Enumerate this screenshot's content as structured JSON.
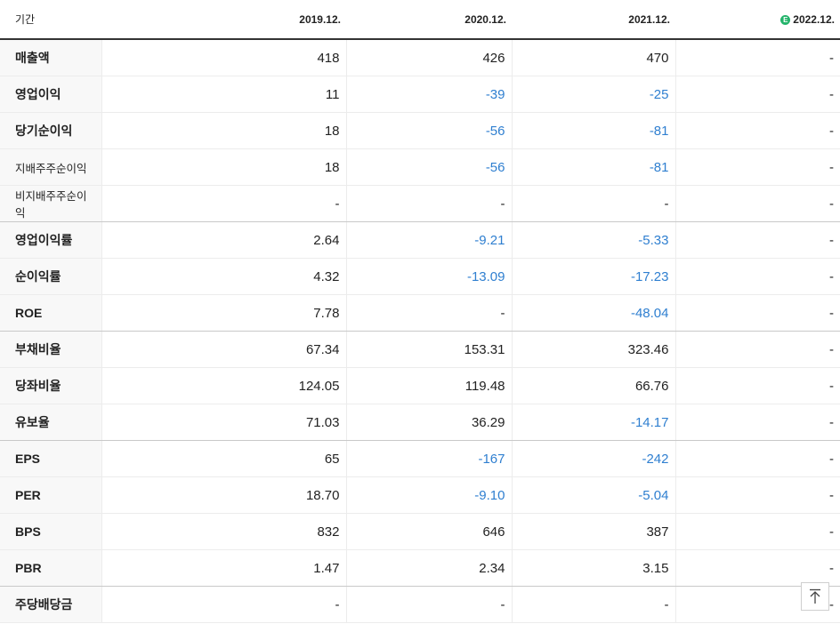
{
  "table": {
    "header": [
      "기간",
      "2019.12.",
      "2020.12.",
      "2021.12.",
      "2022.12."
    ],
    "estimate_icon": "E",
    "rows": [
      {
        "label": "매출액",
        "values": [
          "418",
          "426",
          "470",
          "-"
        ]
      },
      {
        "label": "영업이익",
        "values": [
          "11",
          "-39",
          "-25",
          "-"
        ]
      },
      {
        "label": "당기순이익",
        "values": [
          "18",
          "-56",
          "-81",
          "-"
        ]
      },
      {
        "label": "지배주주순이익",
        "values": [
          "18",
          "-56",
          "-81",
          "-"
        ]
      },
      {
        "label": "비지배주주순이익",
        "values": [
          "-",
          "-",
          "-",
          "-"
        ]
      },
      {
        "label": "영업이익률",
        "values": [
          "2.64",
          "-9.21",
          "-5.33",
          "-"
        ]
      },
      {
        "label": "순이익률",
        "values": [
          "4.32",
          "-13.09",
          "-17.23",
          "-"
        ]
      },
      {
        "label": "ROE",
        "values": [
          "7.78",
          "-",
          "-48.04",
          "-"
        ]
      },
      {
        "label": "부채비율",
        "values": [
          "67.34",
          "153.31",
          "323.46",
          "-"
        ]
      },
      {
        "label": "당좌비율",
        "values": [
          "124.05",
          "119.48",
          "66.76",
          "-"
        ]
      },
      {
        "label": "유보율",
        "values": [
          "71.03",
          "36.29",
          "-14.17",
          "-"
        ]
      },
      {
        "label": "EPS",
        "values": [
          "65",
          "-167",
          "-242",
          "-"
        ]
      },
      {
        "label": "PER",
        "values": [
          "18.70",
          "-9.10",
          "-5.04",
          "-"
        ]
      },
      {
        "label": "BPS",
        "values": [
          "832",
          "646",
          "387",
          "-"
        ]
      },
      {
        "label": "PBR",
        "values": [
          "1.47",
          "2.34",
          "3.15",
          "-"
        ]
      },
      {
        "label": "주당배당금",
        "values": [
          "-",
          "-",
          "-",
          "-"
        ]
      }
    ]
  },
  "colors": {
    "negative": "#2f7fd0",
    "estimate": "#23b36a"
  },
  "scroll_top_icon": "arrow-up-to-top-icon"
}
